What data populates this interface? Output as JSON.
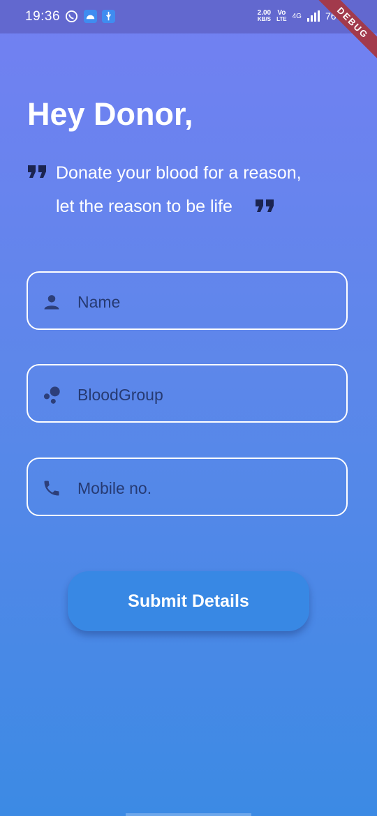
{
  "status_bar": {
    "time": "19:36",
    "speed_value": "2.00",
    "speed_unit": "KB/S",
    "volte_top": "Vo",
    "volte_bottom": "LTE",
    "network": "4G",
    "battery": "76%"
  },
  "debug_banner": "DEBUG",
  "header": {
    "title": "Hey Donor,",
    "quote_line_1": "Donate your blood for a reason,",
    "quote_line_2": "let the reason to be life"
  },
  "form": {
    "name_placeholder": "Name",
    "blood_group_placeholder": "BloodGroup",
    "mobile_placeholder": "Mobile no."
  },
  "submit_label": "Submit Details",
  "colors": {
    "status_bar": "#6268CF",
    "gradient_top": "#7380F2",
    "gradient_bottom": "#3C8AE4",
    "button": "#3888E4",
    "input_text": "#263A72",
    "debug_ribbon": "#A23A4C"
  },
  "icons": [
    "whatsapp-icon",
    "android-icon",
    "usb-icon",
    "signal-icon",
    "person-icon",
    "bubble-chart-icon",
    "phone-icon",
    "format-quote-icon"
  ]
}
